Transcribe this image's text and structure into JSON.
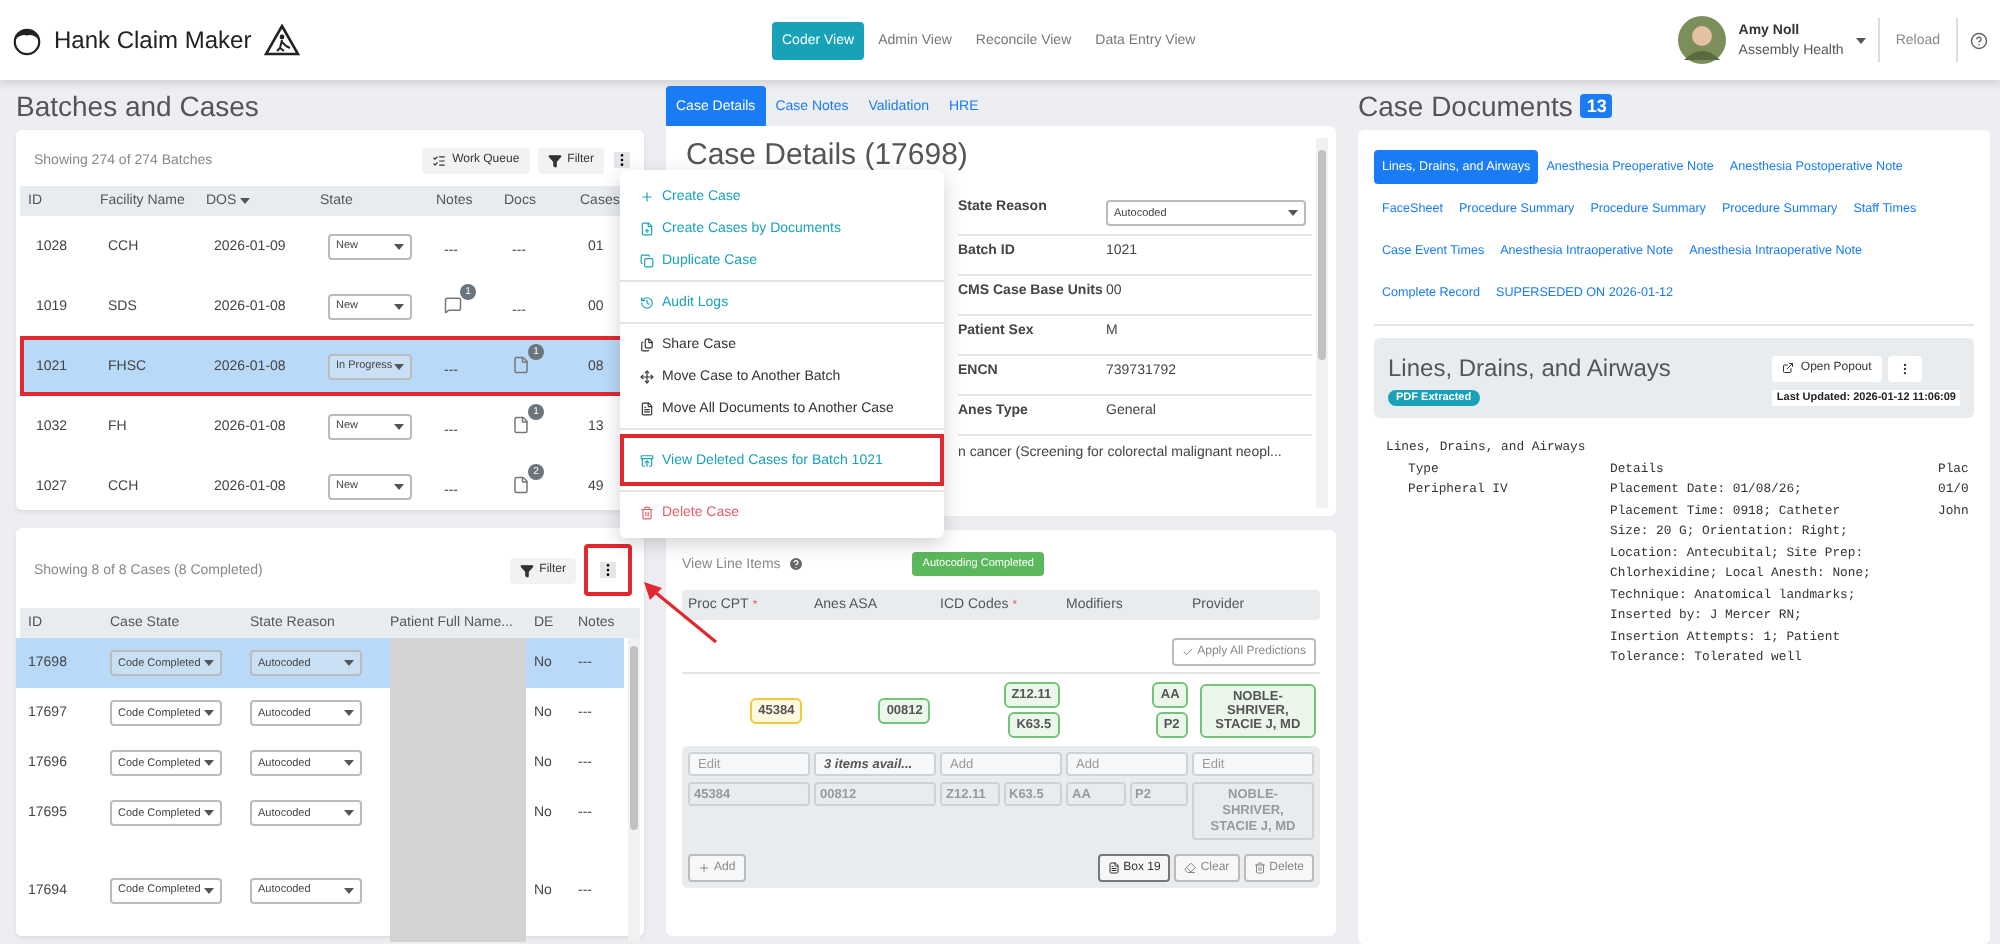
{
  "app": {
    "title": "Hank Claim Maker"
  },
  "nav": [
    {
      "label": "Coder View",
      "selected": true
    },
    {
      "label": "Admin View",
      "selected": false
    },
    {
      "label": "Reconcile View",
      "selected": false
    },
    {
      "label": "Data Entry View",
      "selected": false
    }
  ],
  "user": {
    "name": "Amy Noll",
    "org": "Assembly Health",
    "reload": "Reload"
  },
  "batches": {
    "heading": "Batches and Cases",
    "showing": "Showing 274 of 274 Batches",
    "work_queue": "Work Queue",
    "filter": "Filter",
    "columns": [
      "ID",
      "Facility Name",
      "DOS",
      "State",
      "Notes",
      "Docs",
      "Cases"
    ],
    "rows": [
      {
        "id": "1028",
        "facility": "CCH",
        "dos": "2026-01-09",
        "state": "New",
        "notes": {
          "kind": "text",
          "text": "---"
        },
        "docs": {
          "kind": "text",
          "text": "---"
        },
        "cases": "01",
        "selected": false,
        "highlighted": false
      },
      {
        "id": "1019",
        "facility": "SDS",
        "dos": "2026-01-08",
        "state": "New",
        "notes": {
          "kind": "comment",
          "count": "1"
        },
        "docs": {
          "kind": "text",
          "text": "---"
        },
        "cases": "00",
        "selected": false,
        "highlighted": false
      },
      {
        "id": "1021",
        "facility": "FHSC",
        "dos": "2026-01-08",
        "state": "In Progress",
        "notes": {
          "kind": "text",
          "text": "---"
        },
        "docs": {
          "kind": "document",
          "count": "1"
        },
        "cases": "08",
        "selected": true,
        "highlighted": true
      },
      {
        "id": "1032",
        "facility": "FH",
        "dos": "2026-01-08",
        "state": "New",
        "notes": {
          "kind": "text",
          "text": "---"
        },
        "docs": {
          "kind": "document",
          "count": "1"
        },
        "cases": "13",
        "selected": false,
        "highlighted": false
      },
      {
        "id": "1027",
        "facility": "CCH",
        "dos": "2026-01-08",
        "state": "New",
        "notes": {
          "kind": "text",
          "text": "---"
        },
        "docs": {
          "kind": "document",
          "count": "2"
        },
        "cases": "49",
        "selected": false,
        "highlighted": false
      }
    ]
  },
  "cases": {
    "showing": "Showing 8 of 8 Cases (8 Completed)",
    "filter": "Filter",
    "menu_highlighted": true,
    "columns": [
      "ID",
      "Case State",
      "State Reason",
      "Patient Full Name...",
      "DE",
      "Notes"
    ],
    "rows": [
      {
        "id": "17698",
        "state": "Code Completed",
        "reason": "Autocoded",
        "de": "No",
        "notes": "---",
        "selected": true
      },
      {
        "id": "17697",
        "state": "Code Completed",
        "reason": "Autocoded",
        "de": "No",
        "notes": "---",
        "selected": false
      },
      {
        "id": "17696",
        "state": "Code Completed",
        "reason": "Autocoded",
        "de": "No",
        "notes": "---",
        "selected": false
      },
      {
        "id": "17695",
        "state": "Code Completed",
        "reason": "Autocoded",
        "de": "No",
        "notes": "---",
        "selected": false
      },
      {
        "id": "17694",
        "state": "Code Completed",
        "reason": "Autocoded",
        "de": "No",
        "notes": "---",
        "selected": false
      }
    ]
  },
  "case_menu": [
    [
      {
        "label": "Create Case",
        "kind": "primary",
        "highlighted": false
      },
      {
        "label": "Create Cases by Documents",
        "kind": "primary",
        "highlighted": false
      },
      {
        "label": "Duplicate Case",
        "kind": "primary",
        "highlighted": false
      }
    ],
    [
      {
        "label": "Audit Logs",
        "kind": "primary",
        "highlighted": false
      }
    ],
    [
      {
        "label": "Share Case",
        "kind": "plain",
        "highlighted": false
      },
      {
        "label": "Move Case to Another Batch",
        "kind": "plain",
        "highlighted": false
      },
      {
        "label": "Move All Documents to Another Case",
        "kind": "plain",
        "highlighted": false
      }
    ],
    [
      {
        "label": "View Deleted Cases for Batch 1021",
        "kind": "primary",
        "highlighted": true
      }
    ],
    [
      {
        "label": "Delete Case",
        "kind": "danger",
        "highlighted": false
      }
    ]
  ],
  "detail_tabs": [
    {
      "label": "Case Details",
      "selected": true
    },
    {
      "label": "Case Notes",
      "selected": false
    },
    {
      "label": "Validation",
      "selected": false
    },
    {
      "label": "HRE",
      "selected": false
    }
  ],
  "details": {
    "title": "Case Details (17698)",
    "fields": [
      {
        "label": "State Reason",
        "value": "Autocoded",
        "kind": "select"
      },
      {
        "label": "Batch ID",
        "value": "1021",
        "kind": "text"
      },
      {
        "label": "CMS Case Base Units",
        "value": "00",
        "kind": "text"
      },
      {
        "label": "Patient Sex",
        "value": "M",
        "kind": "text"
      },
      {
        "label": "ENCN",
        "value": "739731792",
        "kind": "text"
      },
      {
        "label": "Anes Type",
        "value": "General",
        "kind": "text"
      }
    ],
    "diagnosis": "n cancer (Screening for colorectal malignant neopl..."
  },
  "line_items": {
    "title": "View Line Items",
    "badge": "Autocoding Completed",
    "columns": [
      {
        "label": "Proc CPT",
        "mark": "*"
      },
      {
        "label": "Anes ASA"
      },
      {
        "label": "ICD Codes",
        "mark": "*"
      },
      {
        "label": "Modifiers"
      },
      {
        "label": "Provider"
      }
    ],
    "apply": "Apply All Predictions",
    "predictions": [
      [
        {
          "text": "45384",
          "kind": "warning"
        }
      ],
      [
        {
          "text": "00812",
          "kind": "match"
        }
      ],
      [
        {
          "text": "Z12.11",
          "kind": "match"
        },
        {
          "text": "K63.5",
          "kind": "match"
        }
      ],
      [
        {
          "text": "AA",
          "kind": "match"
        },
        {
          "text": "P2",
          "kind": "match"
        }
      ],
      [
        {
          "text": "NOBLE-SHRIVER, STACIE J, MD",
          "kind": "match"
        }
      ]
    ],
    "entry_fields": [
      {
        "placeholder": "Edit"
      },
      {
        "value": "3 items avail..."
      },
      {
        "placeholder": "Add"
      },
      {
        "placeholder": "Add"
      },
      {
        "placeholder": "Edit"
      }
    ],
    "values": [
      [
        "45384"
      ],
      [
        "00812"
      ],
      [
        "Z12.11",
        "K63.5"
      ],
      [
        "AA",
        "P2"
      ],
      [
        "NOBLE-SHRIVER, STACIE J, MD"
      ]
    ],
    "add": "Add",
    "box19": "Box 19",
    "clear": "Clear",
    "delete": "Delete"
  },
  "documents": {
    "heading": "Case Documents",
    "count": "13",
    "tabs": [
      {
        "label": "Lines, Drains, and Airways",
        "selected": true
      },
      {
        "label": "Anesthesia Preoperative Note",
        "selected": false
      },
      {
        "label": "Anesthesia Postoperative Note",
        "selected": false
      },
      {
        "label": "FaceSheet",
        "selected": false
      },
      {
        "label": "Procedure Summary",
        "selected": false
      },
      {
        "label": "Procedure Summary",
        "selected": false
      },
      {
        "label": "Procedure Summary",
        "selected": false
      },
      {
        "label": "Staff Times",
        "selected": false
      },
      {
        "label": "Case Event Times",
        "selected": false
      },
      {
        "label": "Anesthesia Intraoperative Note",
        "selected": false
      },
      {
        "label": "Anesthesia Intraoperative Note",
        "selected": false
      },
      {
        "label": "Complete Record",
        "selected": false
      },
      {
        "label": "SUPERSEDED ON 2026-01-12",
        "selected": false
      }
    ],
    "title": "Lines, Drains, and Airways",
    "badge": "PDF Extracted",
    "popout": "Open Popout",
    "updated": "Last Updated: 2026-01-12 11:06:09",
    "content": {
      "heading": "Lines, Drains, and Airways",
      "columns": [
        "Type",
        "Details",
        "Plac"
      ],
      "rows": [
        {
          "type": "Peripheral IV",
          "details": "Placement Date: 01/08/26; Placement Time: 0918; Catheter Size: 20 G; Orientation: Right; Location: Antecubital; Site Prep: Chlorhexidine; Local Anesth: None; Technique: Anatomical landmarks; Inserted by: J Mercer RN; Insertion Attempts: 1; Patient Tolerance: Tolerated well",
          "column_3": [
            "01/0",
            "John"
          ]
        }
      ]
    }
  }
}
